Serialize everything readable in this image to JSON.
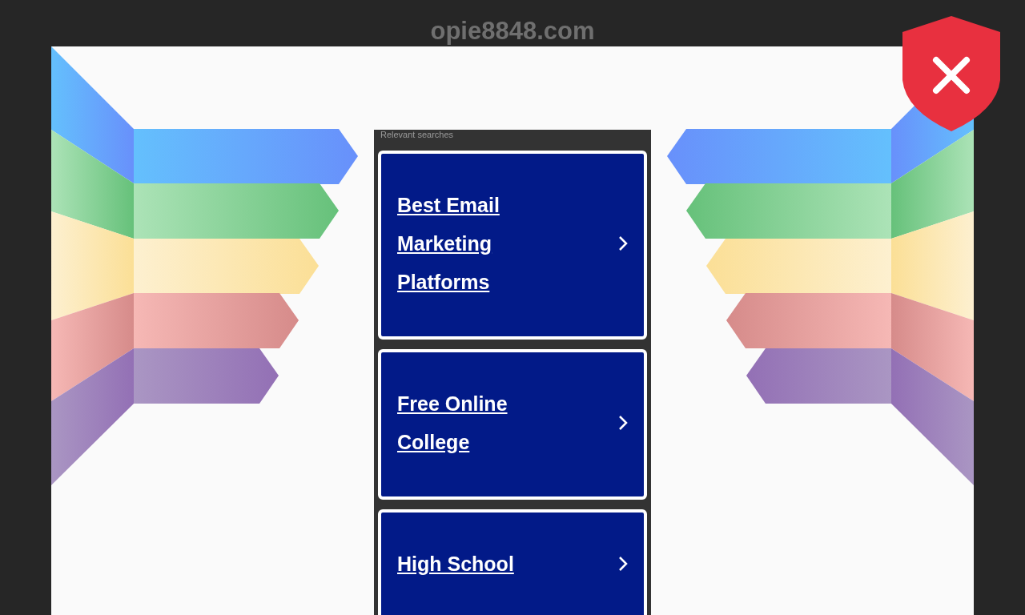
{
  "header": {
    "domain": "opie8848.com"
  },
  "searches": {
    "heading": "Relevant searches",
    "results": [
      {
        "label": "Best Email Marketing Platforms"
      },
      {
        "label": "Free Online College"
      },
      {
        "label": "High School"
      }
    ]
  }
}
